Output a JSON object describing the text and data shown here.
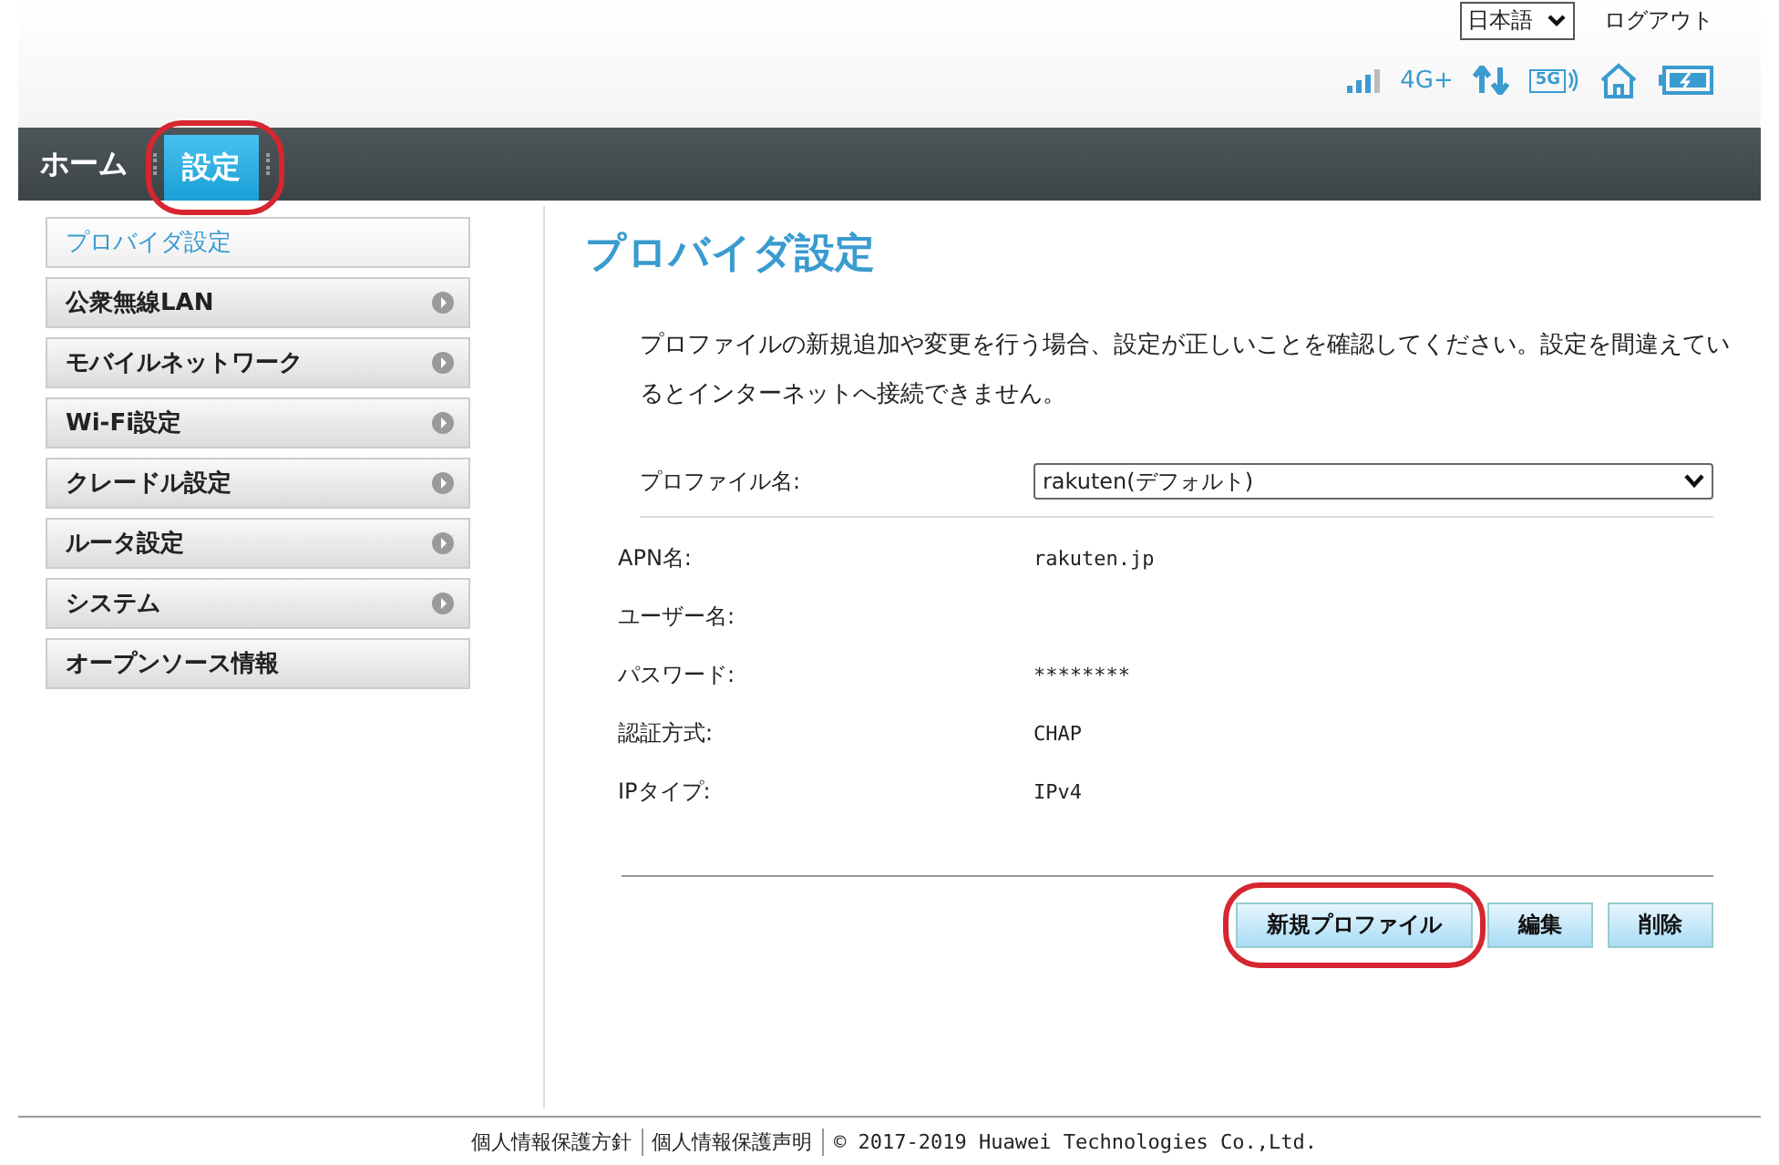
{
  "top_bar": {
    "language": "日本語",
    "logout": "ログアウト"
  },
  "status": {
    "network_type": "4G+",
    "wifi_band": "5G"
  },
  "nav_tabs": [
    {
      "label": "ホーム",
      "selected": false,
      "highlighted": false
    },
    {
      "label": "設定",
      "selected": true,
      "highlighted": true
    }
  ],
  "sidebar": {
    "items": [
      {
        "label": "プロバイダ設定",
        "selected": true,
        "has_arrow": false
      },
      {
        "label": "公衆無線LAN",
        "selected": false,
        "has_arrow": true
      },
      {
        "label": "モバイルネットワーク",
        "selected": false,
        "has_arrow": true
      },
      {
        "label": "Wi-Fi設定",
        "selected": false,
        "has_arrow": true
      },
      {
        "label": "クレードル設定",
        "selected": false,
        "has_arrow": true
      },
      {
        "label": "ルータ設定",
        "selected": false,
        "has_arrow": true
      },
      {
        "label": "システム",
        "selected": false,
        "has_arrow": true
      },
      {
        "label": "オープンソース情報",
        "selected": false,
        "has_arrow": false
      }
    ]
  },
  "page": {
    "title": "プロバイダ設定",
    "description": "プロファイルの新規追加や変更を行う場合、設定が正しいことを確認してください。設定を間違えているとインターネットへ接続できません。",
    "profile_select": {
      "label": "プロファイル名:",
      "value": "rakuten(デフォルト)"
    },
    "fields": [
      {
        "label": "APN名:",
        "value": "rakuten.jp"
      },
      {
        "label": "ユーザー名:"
      },
      {
        "label": "パスワード:",
        "value": "********"
      },
      {
        "label": "認証方式:",
        "value": "CHAP"
      },
      {
        "label": "IPタイプ:",
        "value": "IPv4"
      }
    ],
    "buttons": [
      {
        "label": "新規プロファイル",
        "highlighted": true
      },
      {
        "label": "編集",
        "highlighted": false
      },
      {
        "label": "削除",
        "highlighted": false
      }
    ]
  },
  "footer": {
    "links": [
      "個人情報保護方針",
      "個人情報保護声明"
    ],
    "copyright": "© 2017-2019 Huawei Technologies Co.,Ltd."
  }
}
